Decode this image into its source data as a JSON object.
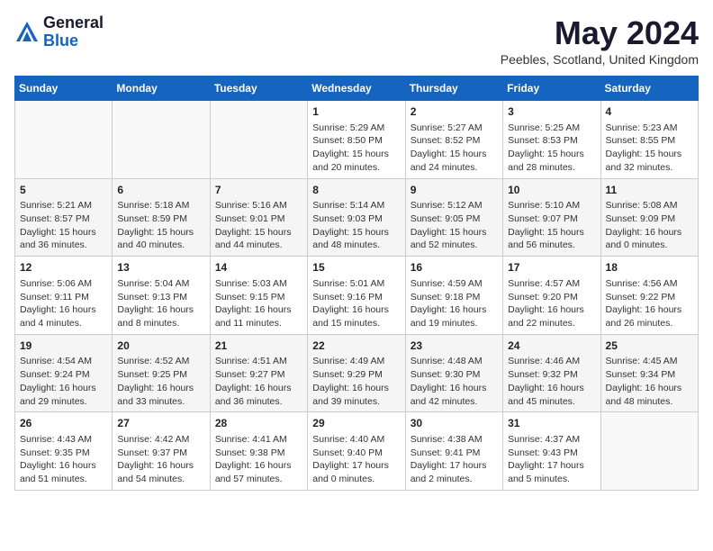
{
  "logo": {
    "general": "General",
    "blue": "Blue"
  },
  "title": "May 2024",
  "location": "Peebles, Scotland, United Kingdom",
  "days_of_week": [
    "Sunday",
    "Monday",
    "Tuesday",
    "Wednesday",
    "Thursday",
    "Friday",
    "Saturday"
  ],
  "weeks": [
    [
      {
        "day": "",
        "info": ""
      },
      {
        "day": "",
        "info": ""
      },
      {
        "day": "",
        "info": ""
      },
      {
        "day": "1",
        "info": "Sunrise: 5:29 AM\nSunset: 8:50 PM\nDaylight: 15 hours\nand 20 minutes."
      },
      {
        "day": "2",
        "info": "Sunrise: 5:27 AM\nSunset: 8:52 PM\nDaylight: 15 hours\nand 24 minutes."
      },
      {
        "day": "3",
        "info": "Sunrise: 5:25 AM\nSunset: 8:53 PM\nDaylight: 15 hours\nand 28 minutes."
      },
      {
        "day": "4",
        "info": "Sunrise: 5:23 AM\nSunset: 8:55 PM\nDaylight: 15 hours\nand 32 minutes."
      }
    ],
    [
      {
        "day": "5",
        "info": "Sunrise: 5:21 AM\nSunset: 8:57 PM\nDaylight: 15 hours\nand 36 minutes."
      },
      {
        "day": "6",
        "info": "Sunrise: 5:18 AM\nSunset: 8:59 PM\nDaylight: 15 hours\nand 40 minutes."
      },
      {
        "day": "7",
        "info": "Sunrise: 5:16 AM\nSunset: 9:01 PM\nDaylight: 15 hours\nand 44 minutes."
      },
      {
        "day": "8",
        "info": "Sunrise: 5:14 AM\nSunset: 9:03 PM\nDaylight: 15 hours\nand 48 minutes."
      },
      {
        "day": "9",
        "info": "Sunrise: 5:12 AM\nSunset: 9:05 PM\nDaylight: 15 hours\nand 52 minutes."
      },
      {
        "day": "10",
        "info": "Sunrise: 5:10 AM\nSunset: 9:07 PM\nDaylight: 15 hours\nand 56 minutes."
      },
      {
        "day": "11",
        "info": "Sunrise: 5:08 AM\nSunset: 9:09 PM\nDaylight: 16 hours\nand 0 minutes."
      }
    ],
    [
      {
        "day": "12",
        "info": "Sunrise: 5:06 AM\nSunset: 9:11 PM\nDaylight: 16 hours\nand 4 minutes."
      },
      {
        "day": "13",
        "info": "Sunrise: 5:04 AM\nSunset: 9:13 PM\nDaylight: 16 hours\nand 8 minutes."
      },
      {
        "day": "14",
        "info": "Sunrise: 5:03 AM\nSunset: 9:15 PM\nDaylight: 16 hours\nand 11 minutes."
      },
      {
        "day": "15",
        "info": "Sunrise: 5:01 AM\nSunset: 9:16 PM\nDaylight: 16 hours\nand 15 minutes."
      },
      {
        "day": "16",
        "info": "Sunrise: 4:59 AM\nSunset: 9:18 PM\nDaylight: 16 hours\nand 19 minutes."
      },
      {
        "day": "17",
        "info": "Sunrise: 4:57 AM\nSunset: 9:20 PM\nDaylight: 16 hours\nand 22 minutes."
      },
      {
        "day": "18",
        "info": "Sunrise: 4:56 AM\nSunset: 9:22 PM\nDaylight: 16 hours\nand 26 minutes."
      }
    ],
    [
      {
        "day": "19",
        "info": "Sunrise: 4:54 AM\nSunset: 9:24 PM\nDaylight: 16 hours\nand 29 minutes."
      },
      {
        "day": "20",
        "info": "Sunrise: 4:52 AM\nSunset: 9:25 PM\nDaylight: 16 hours\nand 33 minutes."
      },
      {
        "day": "21",
        "info": "Sunrise: 4:51 AM\nSunset: 9:27 PM\nDaylight: 16 hours\nand 36 minutes."
      },
      {
        "day": "22",
        "info": "Sunrise: 4:49 AM\nSunset: 9:29 PM\nDaylight: 16 hours\nand 39 minutes."
      },
      {
        "day": "23",
        "info": "Sunrise: 4:48 AM\nSunset: 9:30 PM\nDaylight: 16 hours\nand 42 minutes."
      },
      {
        "day": "24",
        "info": "Sunrise: 4:46 AM\nSunset: 9:32 PM\nDaylight: 16 hours\nand 45 minutes."
      },
      {
        "day": "25",
        "info": "Sunrise: 4:45 AM\nSunset: 9:34 PM\nDaylight: 16 hours\nand 48 minutes."
      }
    ],
    [
      {
        "day": "26",
        "info": "Sunrise: 4:43 AM\nSunset: 9:35 PM\nDaylight: 16 hours\nand 51 minutes."
      },
      {
        "day": "27",
        "info": "Sunrise: 4:42 AM\nSunset: 9:37 PM\nDaylight: 16 hours\nand 54 minutes."
      },
      {
        "day": "28",
        "info": "Sunrise: 4:41 AM\nSunset: 9:38 PM\nDaylight: 16 hours\nand 57 minutes."
      },
      {
        "day": "29",
        "info": "Sunrise: 4:40 AM\nSunset: 9:40 PM\nDaylight: 17 hours\nand 0 minutes."
      },
      {
        "day": "30",
        "info": "Sunrise: 4:38 AM\nSunset: 9:41 PM\nDaylight: 17 hours\nand 2 minutes."
      },
      {
        "day": "31",
        "info": "Sunrise: 4:37 AM\nSunset: 9:43 PM\nDaylight: 17 hours\nand 5 minutes."
      },
      {
        "day": "",
        "info": ""
      }
    ]
  ]
}
